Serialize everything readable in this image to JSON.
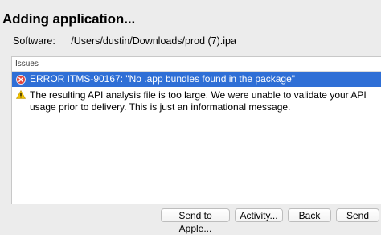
{
  "dialog": {
    "title": "Adding application...",
    "software_label": "Software:",
    "software_path": "/Users/dustin/Downloads/prod (7).ipa"
  },
  "issues": {
    "header": "Issues",
    "items": [
      {
        "type": "error",
        "icon": "error-x-icon",
        "text": "ERROR ITMS-90167: \"No .app bundles found in the package\"",
        "selected": true
      },
      {
        "type": "warning",
        "icon": "warning-triangle-icon",
        "text": "The resulting API analysis file is too large.  We were unable to validate your API usage prior to delivery.  This is just an informational message.",
        "selected": false
      }
    ]
  },
  "buttons": {
    "send_to_apple": "Send to Apple...",
    "activity": "Activity...",
    "back": "Back",
    "send": "Send"
  },
  "colors": {
    "selection": "#2f6fd6",
    "error_icon": "#e0443e",
    "warning_icon": "#f2c200"
  }
}
